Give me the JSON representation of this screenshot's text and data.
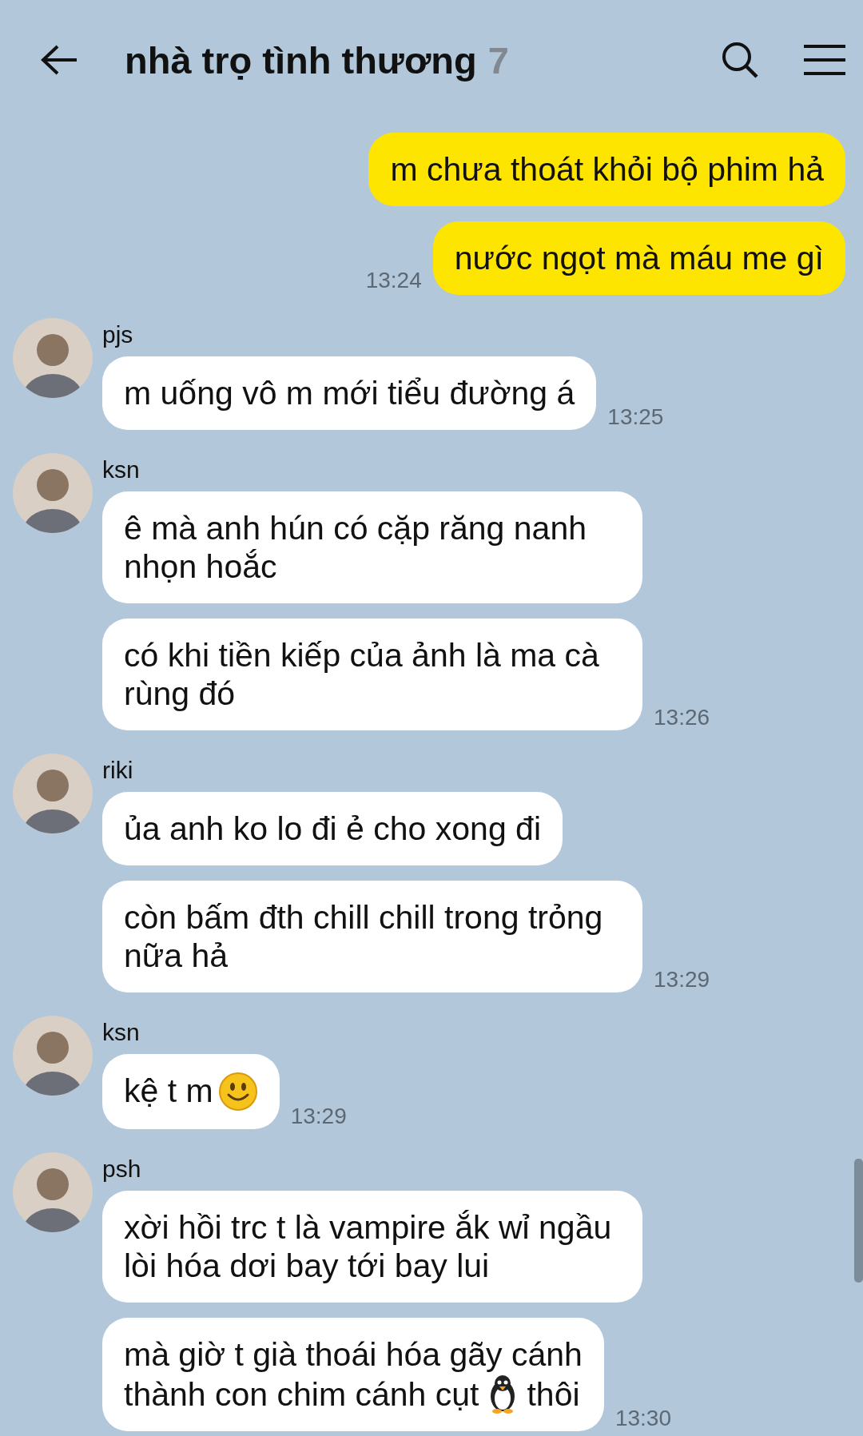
{
  "header": {
    "title": "nhà trọ tình thương",
    "member_count": "7"
  },
  "my_messages": {
    "messages": [
      {
        "text": "m chưa thoát khỏi bộ phim hả"
      },
      {
        "text": "nước ngọt mà máu me gì"
      }
    ],
    "time": "13:24"
  },
  "groups": [
    {
      "sender": "pjs",
      "messages": [
        {
          "text": "m uống vô m mới tiểu đường á"
        }
      ],
      "time": "13:25"
    },
    {
      "sender": "ksn",
      "messages": [
        {
          "text": "ê mà anh hún có cặp răng nanh nhọn hoắc"
        },
        {
          "text": "có khi tiền kiếp của ảnh là ma cà rùng đó"
        }
      ],
      "time": "13:26"
    },
    {
      "sender": "riki",
      "messages": [
        {
          "text": "ủa anh ko lo đi ẻ cho xong đi"
        },
        {
          "text": "còn bấm đth chill chill trong trỏng nữa hả"
        }
      ],
      "time": "13:29"
    },
    {
      "sender": "ksn",
      "messages": [
        {
          "text": "kệ t m",
          "kind": "smiley"
        }
      ],
      "time": "13:29"
    },
    {
      "sender": "psh",
      "messages": [
        {
          "text": "xời hồi trc t là vampire ắk wỉ ngầu lòi hóa dơi bay tới bay lui"
        },
        {
          "text": "mà giờ t già thoái hóa gãy cánh",
          "kind": "penguin",
          "second_line": "thành con chim cánh cụt",
          "text_after": "thôi"
        }
      ],
      "time": "13:30"
    }
  ]
}
